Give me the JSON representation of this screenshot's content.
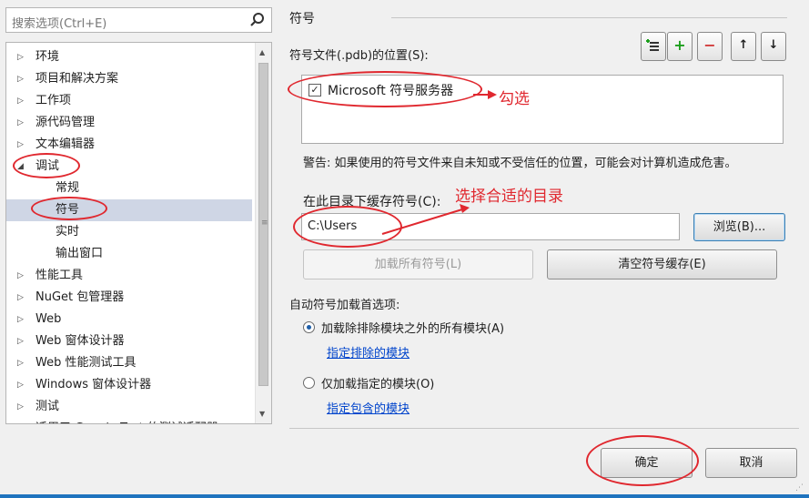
{
  "search": {
    "placeholder": "搜索选项(Ctrl+E)"
  },
  "tree": {
    "items": [
      {
        "label": "环境",
        "arrow": "▷",
        "level": 0
      },
      {
        "label": "项目和解决方案",
        "arrow": "▷",
        "level": 0
      },
      {
        "label": "工作项",
        "arrow": "▷",
        "level": 0
      },
      {
        "label": "源代码管理",
        "arrow": "▷",
        "level": 0
      },
      {
        "label": "文本编辑器",
        "arrow": "▷",
        "level": 0
      },
      {
        "label": "调试",
        "arrow": "◢",
        "level": 0
      },
      {
        "label": "常规",
        "arrow": "",
        "level": 1
      },
      {
        "label": "符号",
        "arrow": "",
        "level": 1,
        "selected": true
      },
      {
        "label": "实时",
        "arrow": "",
        "level": 1
      },
      {
        "label": "输出窗口",
        "arrow": "",
        "level": 1
      },
      {
        "label": "性能工具",
        "arrow": "▷",
        "level": 0
      },
      {
        "label": "NuGet 包管理器",
        "arrow": "▷",
        "level": 0
      },
      {
        "label": "Web",
        "arrow": "▷",
        "level": 0
      },
      {
        "label": "Web 窗体设计器",
        "arrow": "▷",
        "level": 0
      },
      {
        "label": "Web 性能测试工具",
        "arrow": "▷",
        "level": 0
      },
      {
        "label": "Windows 窗体设计器",
        "arrow": "▷",
        "level": 0
      },
      {
        "label": "测试",
        "arrow": "▷",
        "level": 0
      },
      {
        "label": "适用于 Google Test 的测试适配器",
        "arrow": "▷",
        "level": 0
      }
    ]
  },
  "symbols": {
    "title": "符号",
    "location_label": "符号文件(.pdb)的位置(S):",
    "toolbar": {
      "add_folder": "≡",
      "add": "+",
      "remove": "−",
      "up": "↑",
      "down": "↓"
    },
    "servers": [
      {
        "label": "Microsoft 符号服务器",
        "checked": true
      }
    ],
    "warning": "警告: 如果使用的符号文件来自未知或不受信任的位置，可能会对计算机造成危害。",
    "cache_label": "在此目录下缓存符号(C):",
    "cache_value": "C:\\Users",
    "browse_label": "浏览(B)...",
    "load_all_label": "加载所有符号(L)",
    "clear_cache_label": "清空符号缓存(E)",
    "auto_load_label": "自动符号加载首选项:",
    "option_excluded_label": "加载除排除模块之外的所有模块(A)",
    "link_excluded": "指定排除的模块",
    "option_specified_label": "仅加载指定的模块(O)",
    "link_specified": "指定包含的模块"
  },
  "dialog": {
    "ok_label": "确定",
    "cancel_label": "取消"
  },
  "annotations": {
    "check_note": "勾选",
    "dir_note": "选择合适的目录",
    "color": "#e0282f"
  }
}
